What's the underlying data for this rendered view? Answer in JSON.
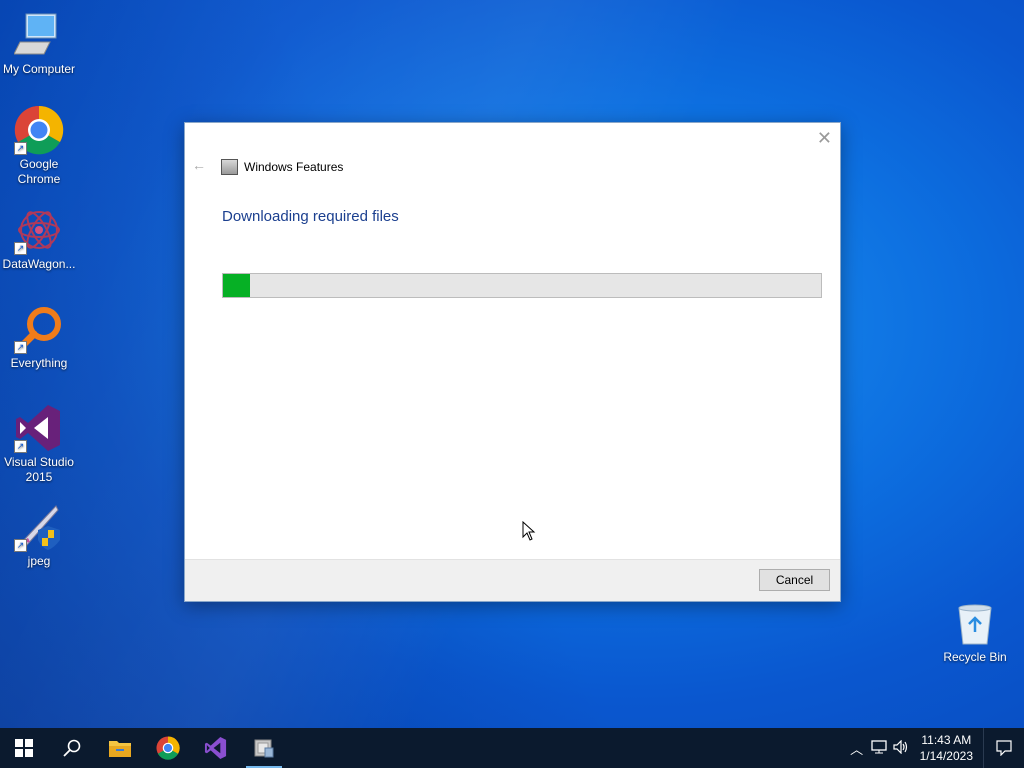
{
  "desktop": {
    "icons": [
      {
        "label": "My Computer"
      },
      {
        "label": "Google Chrome"
      },
      {
        "label": "DataWagon..."
      },
      {
        "label": "Everything"
      },
      {
        "label": "Visual Studio 2015"
      },
      {
        "label": "jpeg"
      }
    ],
    "recycle_bin": {
      "label": "Recycle Bin"
    }
  },
  "dialog": {
    "title": "Windows Features",
    "heading": "Downloading required files",
    "progress_fraction": 0.045,
    "cancel_label": "Cancel",
    "close_icon": "close-icon",
    "back_icon": "back-arrow-icon"
  },
  "taskbar": {
    "apps": [
      "start-icon",
      "search-icon",
      "file-explorer-icon",
      "chrome-icon",
      "visual-studio-icon",
      "windows-features-icon"
    ],
    "clock": {
      "time": "11:43 AM",
      "date": "1/14/2023"
    }
  },
  "colors": {
    "accent": "#06b025",
    "heading": "#1b3f8f",
    "taskbar": "#0b1a2e"
  }
}
